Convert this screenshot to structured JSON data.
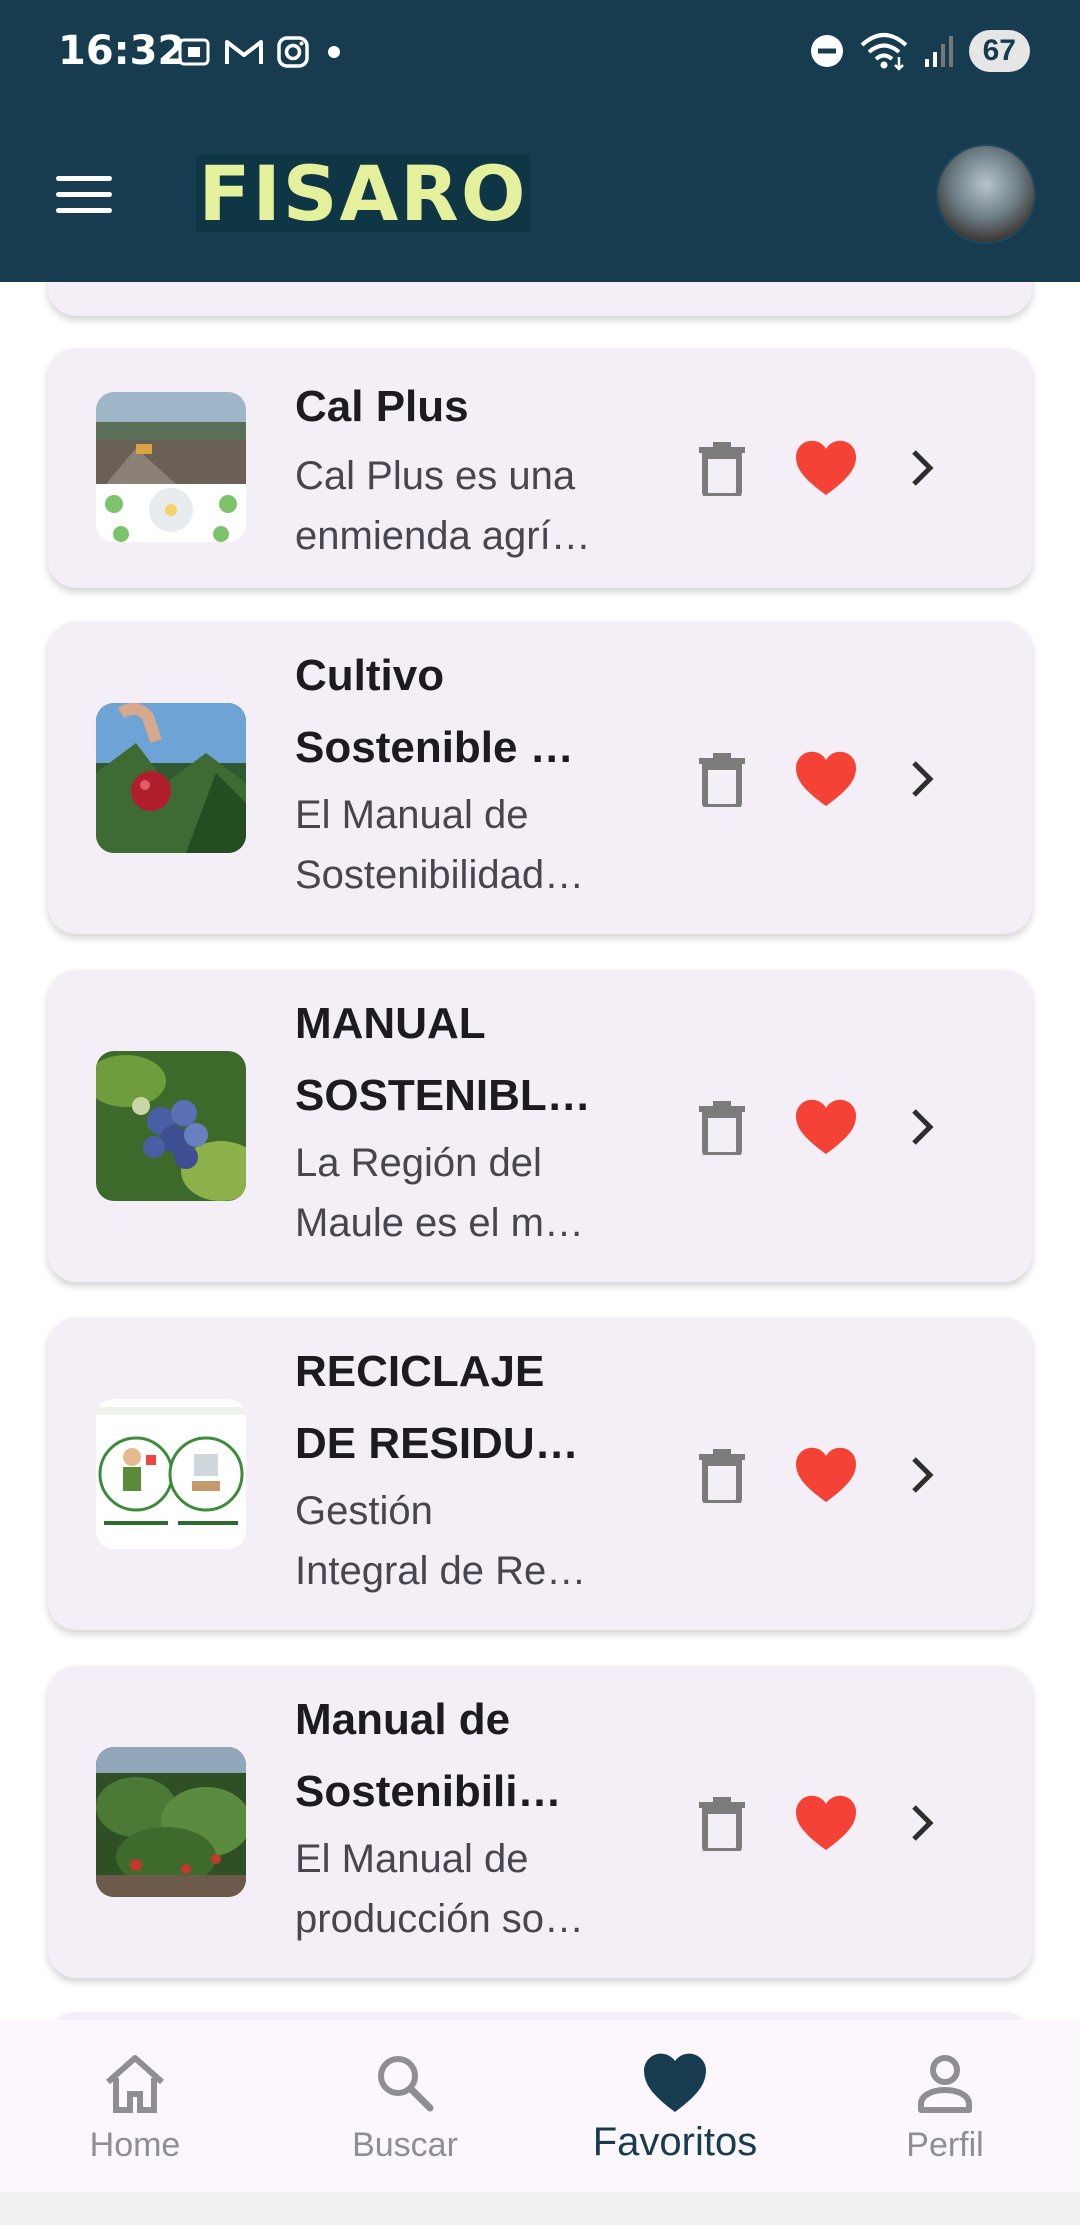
{
  "status": {
    "time": "16:32",
    "battery": "67"
  },
  "app": {
    "logo_text": "FISARO"
  },
  "items": [
    {
      "title_lines": [
        "Cal Plus"
      ],
      "desc_lines": [
        "Cal Plus es una",
        "enmienda agrí…"
      ]
    },
    {
      "title_lines": [
        "Cultivo",
        "Sostenible …"
      ],
      "desc_lines": [
        "El Manual de",
        "Sostenibilidad…"
      ]
    },
    {
      "title_lines": [
        "MANUAL",
        "SOSTENIBL…"
      ],
      "desc_lines": [
        "La Región del",
        "Maule es el m…"
      ]
    },
    {
      "title_lines": [
        "RECICLAJE",
        "DE RESIDU…"
      ],
      "desc_lines": [
        "Gestión",
        "Integral de Re…"
      ]
    },
    {
      "title_lines": [
        "Manual de",
        "Sostenibili…"
      ],
      "desc_lines": [
        "El Manual de",
        "producción so…"
      ]
    }
  ],
  "nav": [
    {
      "label": "Home",
      "icon": "home-icon"
    },
    {
      "label": "Buscar",
      "icon": "search-icon"
    },
    {
      "label": "Favoritos",
      "icon": "heart-icon"
    },
    {
      "label": "Perfil",
      "icon": "person-icon"
    }
  ],
  "colors": {
    "brand": "#173c50",
    "logo": "#e4f09b",
    "heart": "#f44336",
    "card": "#f4eff6"
  }
}
